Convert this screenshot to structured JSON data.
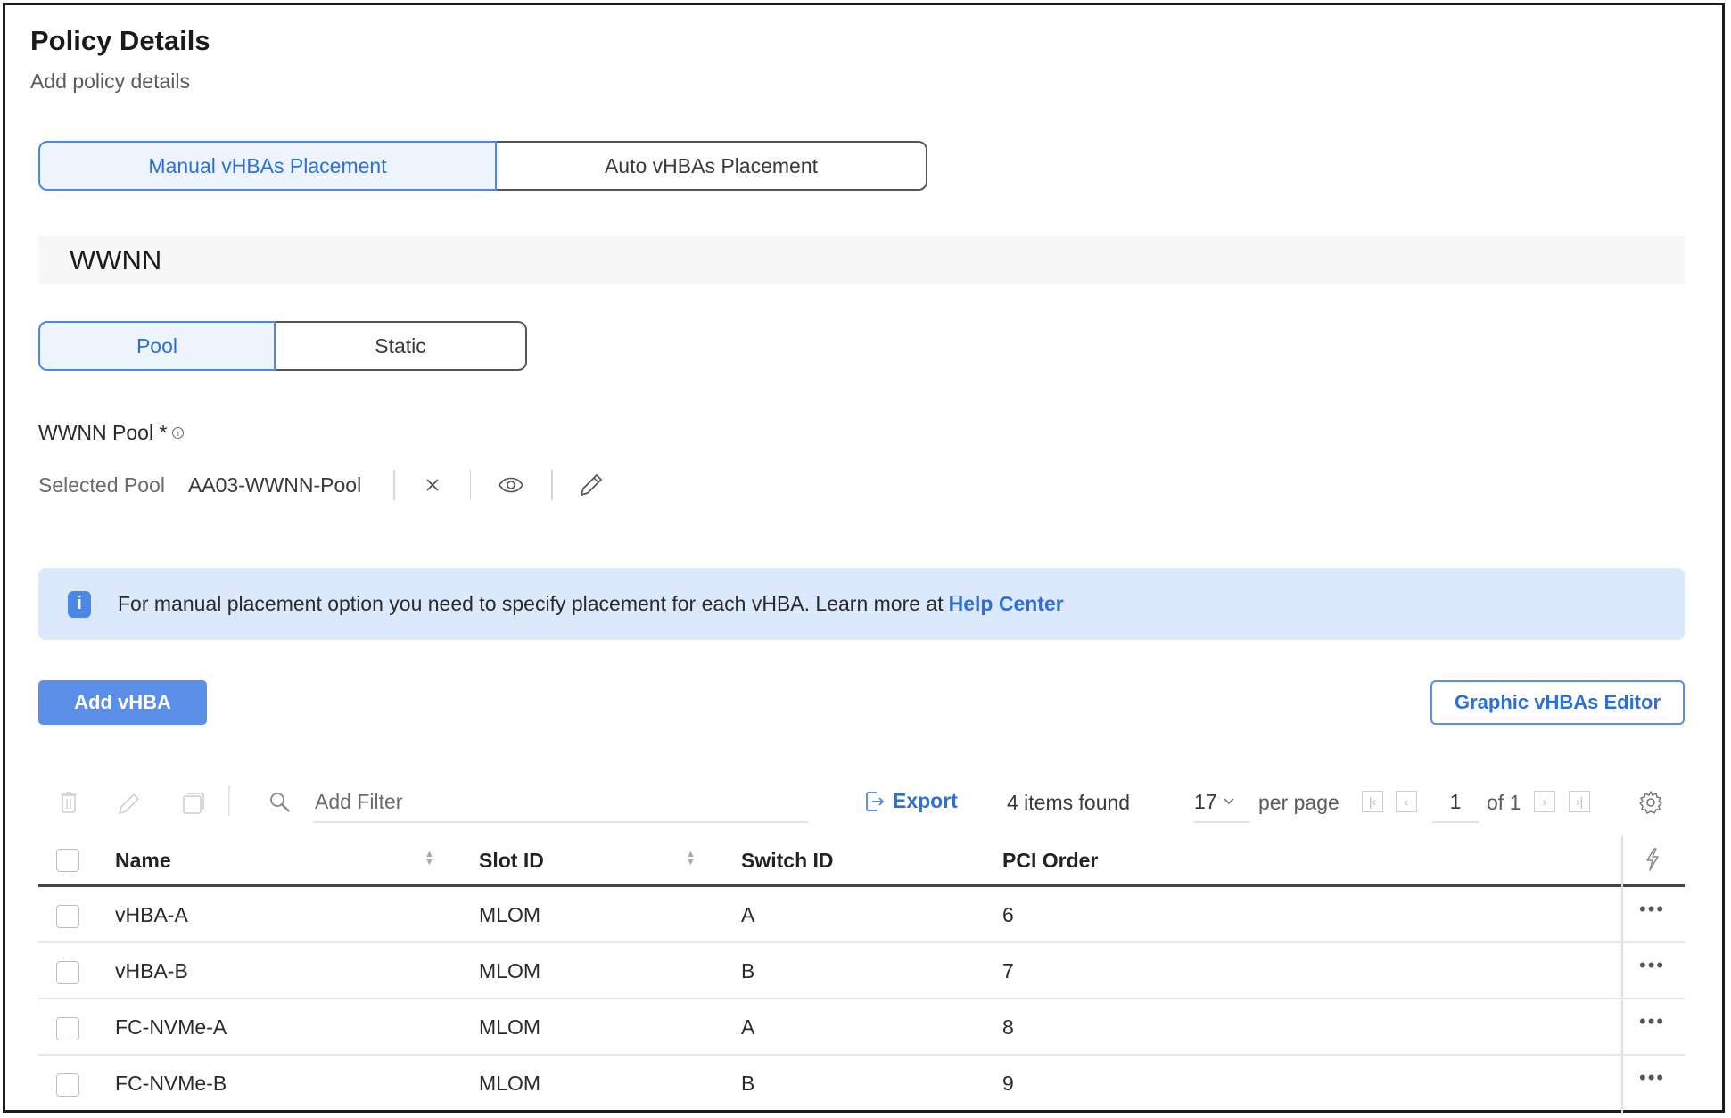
{
  "header": {
    "title": "Policy Details",
    "subtitle": "Add policy details"
  },
  "placement_toggle": {
    "options": [
      "Manual vHBAs Placement",
      "Auto vHBAs Placement"
    ],
    "selected": "Manual vHBAs Placement"
  },
  "wwnn_section": {
    "title": "WWNN",
    "type_toggle": {
      "options": [
        "Pool",
        "Static"
      ],
      "selected": "Pool"
    },
    "pool_label": "WWNN Pool *",
    "selected_pool_label": "Selected Pool",
    "selected_pool_value": "AA03-WWNN-Pool"
  },
  "banner": {
    "message": "For manual placement option you need to specify placement for each vHBA. Learn more at",
    "link_label": "Help Center"
  },
  "actions": {
    "add_label": "Add vHBA",
    "graphic_editor_label": "Graphic vHBAs Editor"
  },
  "toolbar": {
    "filter_placeholder": "Add Filter",
    "export_label": "Export",
    "items_found": "4 items found",
    "per_page_value": "17",
    "per_page_label": "per page",
    "page_value": "1",
    "page_of": "of 1"
  },
  "table": {
    "columns": [
      "Name",
      "Slot ID",
      "Switch ID",
      "PCI Order"
    ],
    "rows": [
      {
        "name": "vHBA-A",
        "slot_id": "MLOM",
        "switch_id": "A",
        "pci_order": "6"
      },
      {
        "name": "vHBA-B",
        "slot_id": "MLOM",
        "switch_id": "B",
        "pci_order": "7"
      },
      {
        "name": "FC-NVMe-A",
        "slot_id": "MLOM",
        "switch_id": "A",
        "pci_order": "8"
      },
      {
        "name": "FC-NVMe-B",
        "slot_id": "MLOM",
        "switch_id": "B",
        "pci_order": "9"
      }
    ]
  },
  "colors": {
    "accent": "#4a88e8",
    "accent_text": "#2d6fd6",
    "banner_bg": "#dce9fd",
    "selected_bg": "#edf4fe"
  }
}
